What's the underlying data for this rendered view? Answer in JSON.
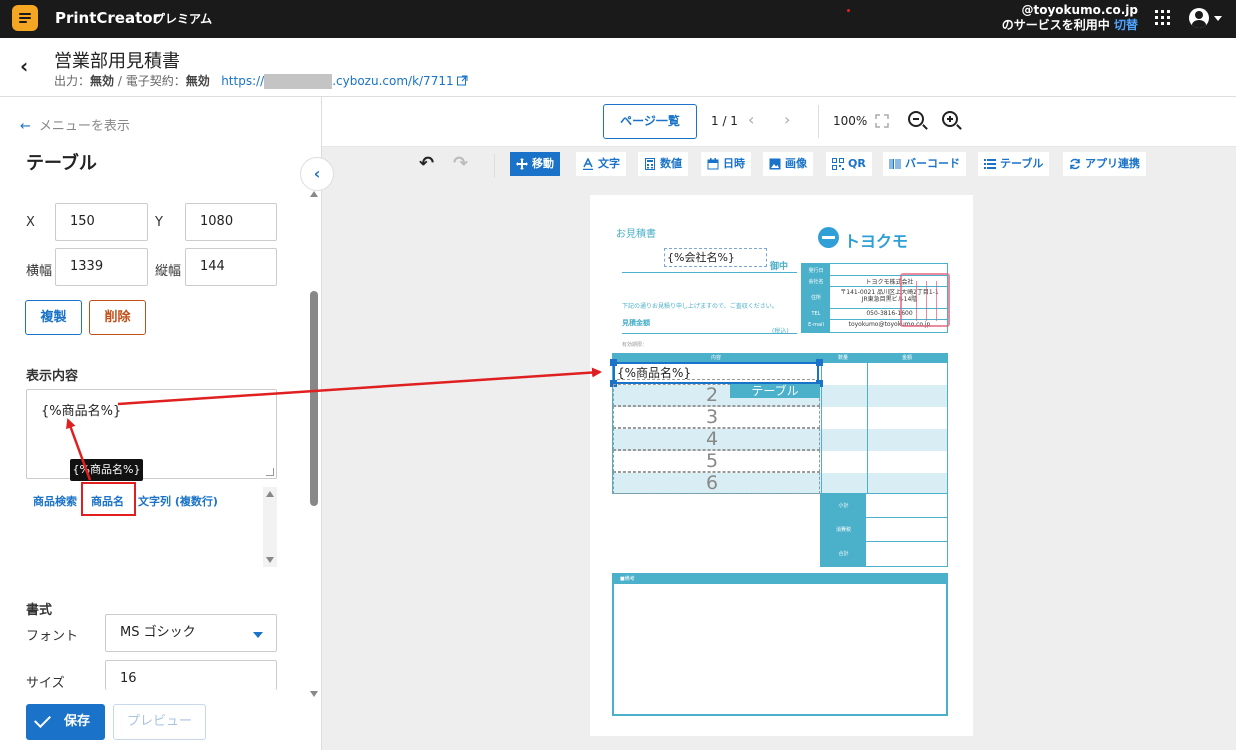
{
  "app": {
    "brand": "PrintCreator",
    "plan": "プレミアム",
    "user_line1": "@toyokumo.co.jp",
    "user_line2": "のサービスを利用中",
    "switch_label": "切替"
  },
  "header": {
    "title": "営業部用見積書",
    "output_label": "出力：",
    "output_value": "無効",
    "sep": " / ",
    "contract_label": "電子契約：",
    "contract_value": "無効",
    "url_prefix": "https://",
    "url_suffix": ".cybozu.com/k/7711"
  },
  "left": {
    "menu_link": "メニューを表示",
    "section_title": "テーブル",
    "x_label": "X",
    "x_value": "150",
    "y_label": "Y",
    "y_value": "1080",
    "w_label": "横幅",
    "w_value": "1339",
    "h_label": "縦幅",
    "h_value": "144",
    "duplicate": "複製",
    "delete": "削除",
    "content_label": "表示内容",
    "content_value": "{%商品名%}",
    "tooltip": "{%商品名%}",
    "chips": [
      "商品検索",
      "商品名",
      "文字列 (複数行)"
    ],
    "format_label": "書式",
    "font_label": "フォント",
    "font_value": "MS ゴシック",
    "size_label": "サイズ",
    "size_value": "16",
    "save": "保存",
    "preview": "プレビュー"
  },
  "canvas_bar": {
    "page_list": "ページ一覧",
    "page_no": "1 / 1",
    "zoom": "100%"
  },
  "tools": [
    "移動",
    "文字",
    "数値",
    "日時",
    "画像",
    "QR",
    "バーコード",
    "テーブル",
    "アプリ連携"
  ],
  "paper": {
    "title": "お見積書",
    "logo": "トヨクモ",
    "company_placeholder": "{%会社名%}",
    "onchu": "御中",
    "info_labels": [
      "発行日",
      "会社名",
      "住所",
      "TEL",
      "E-mail"
    ],
    "info_values": [
      "",
      "トヨクモ株式会社",
      "〒141-0021 品川区上大崎2丁目1-1\nJR東急目黒ビル14階",
      "050-3816-1600",
      "toyokumo@toyokumo.co.jp"
    ],
    "note": "下記の通りお見積り申し上げますので、ご査収ください。",
    "amount_label": "見積金額",
    "tax_label": "(税込)",
    "validity": "有効期限：",
    "col_headers": [
      "内容",
      "数量",
      "金額"
    ],
    "first_cell": "{%商品名%}",
    "row_numbers": [
      "2",
      "3",
      "4",
      "5",
      "6"
    ],
    "table_badge": "テーブル",
    "sum_labels": [
      "小計",
      "消費税",
      "合計"
    ],
    "remark_label": "■備考"
  }
}
